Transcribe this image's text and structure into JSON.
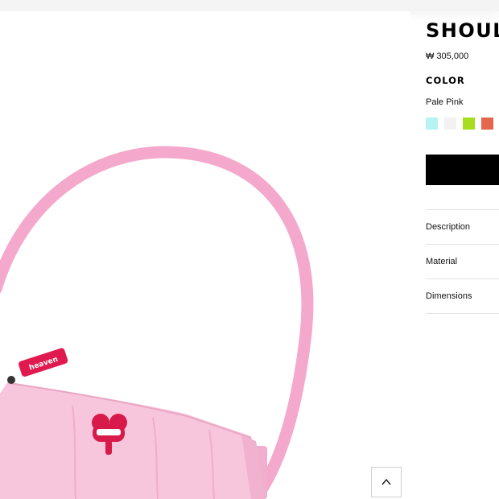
{
  "product": {
    "title": "SHOUL",
    "price": "₩ 305,000",
    "color_heading": "COLOR",
    "selected_color": "Pale Pink",
    "swatches": [
      {
        "name": "Aqua",
        "hex": "#b6f3f3"
      },
      {
        "name": "Off White",
        "hex": "#f3f2f2"
      },
      {
        "name": "Lime",
        "hex": "#a6dd1e"
      },
      {
        "name": "Coral",
        "hex": "#e4664b"
      }
    ],
    "add_button_label": ""
  },
  "accordion": [
    {
      "label": "Description"
    },
    {
      "label": "Material"
    },
    {
      "label": "Dimensions"
    }
  ],
  "image": {
    "badge_text": "heaven",
    "bag_color": "#f6bfd7",
    "strap_color": "#f4a9cc"
  },
  "icons": {
    "scroll_top": "chevron-up-icon"
  }
}
